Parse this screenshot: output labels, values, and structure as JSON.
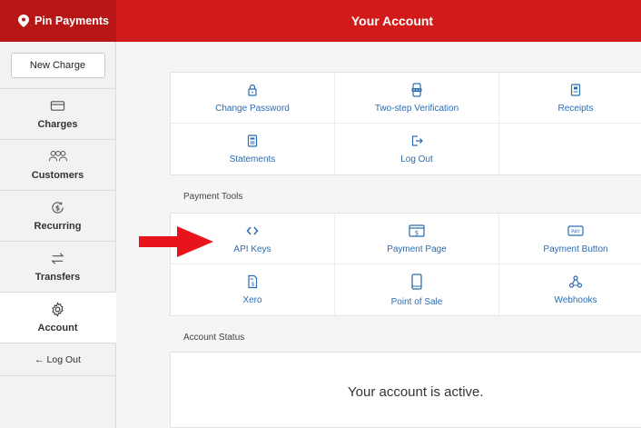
{
  "brand": {
    "name": "Pin Payments"
  },
  "header": {
    "title": "Your Account"
  },
  "sidebar": {
    "new_charge": "New Charge",
    "items": [
      {
        "label": "Charges",
        "icon": "card-icon"
      },
      {
        "label": "Customers",
        "icon": "users-icon"
      },
      {
        "label": "Recurring",
        "icon": "recurring-dollar-icon"
      },
      {
        "label": "Transfers",
        "icon": "transfer-arrows-icon"
      },
      {
        "label": "Account",
        "icon": "gear-icon"
      }
    ],
    "logout": "← Log Out",
    "active": "Account"
  },
  "account_tools": [
    {
      "label": "Change Password",
      "icon": "lock-icon"
    },
    {
      "label": "Two-step Verification",
      "icon": "phone-code-icon"
    },
    {
      "label": "Receipts",
      "icon": "receipt-icon"
    },
    {
      "label": "Statements",
      "icon": "statement-icon"
    },
    {
      "label": "Log Out",
      "icon": "logout-icon"
    }
  ],
  "payment_tools": {
    "title": "Payment Tools",
    "items": [
      {
        "label": "API Keys",
        "icon": "code-brackets-icon"
      },
      {
        "label": "Payment Page",
        "icon": "payment-page-icon"
      },
      {
        "label": "Payment Button",
        "icon": "pay-button-icon"
      },
      {
        "label": "Xero",
        "icon": "document-dollar-icon"
      },
      {
        "label": "Point of Sale",
        "icon": "mobile-icon"
      },
      {
        "label": "Webhooks",
        "icon": "webhooks-icon"
      }
    ]
  },
  "account_status": {
    "title": "Account Status",
    "message": "Your account is active."
  },
  "colors": {
    "brand_red": "#d11a1a",
    "link_blue": "#2b6cb0",
    "arrow_red": "#e8141b"
  }
}
